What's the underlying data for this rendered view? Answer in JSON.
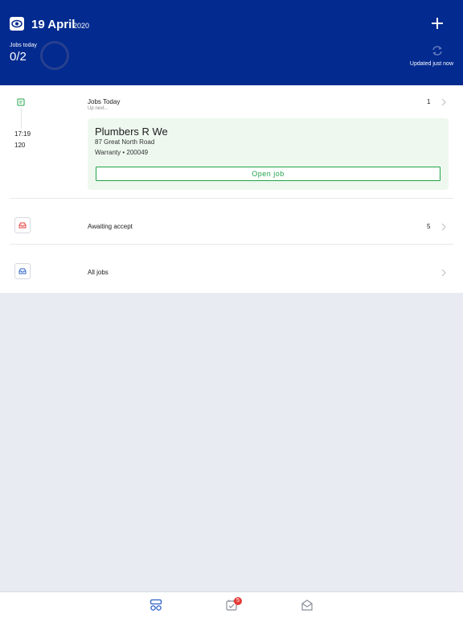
{
  "header": {
    "date_main": "19 April",
    "date_year": "2020",
    "jobs_today_label": "Jobs today",
    "jobs_today_count": "0/2",
    "jobs_progress": 0,
    "updated_text": "Updated just now",
    "background_color": "#022a8f"
  },
  "jobs_today": {
    "title": "Jobs Today",
    "subtitle": "Up next...",
    "count": "1",
    "next_job": {
      "time": "17:19",
      "number": "120",
      "company": "Plumbers R We",
      "address": "87 Great North Road",
      "meta": "Warranty • 200049",
      "open_label": "Open job"
    }
  },
  "awaiting": {
    "title": "Awaiting accept",
    "count": "5"
  },
  "all_jobs": {
    "title": "All jobs"
  },
  "tabbar": {
    "items": [
      {
        "icon": "dashboard-icon",
        "active": true
      },
      {
        "icon": "calendar-check-icon",
        "badge": "5"
      },
      {
        "icon": "mail-icon"
      }
    ]
  },
  "colors": {
    "accent_green": "#22a34a",
    "alert_red": "#e53935",
    "brand_blue": "#022a8f",
    "card_green": "#eef8ef"
  }
}
